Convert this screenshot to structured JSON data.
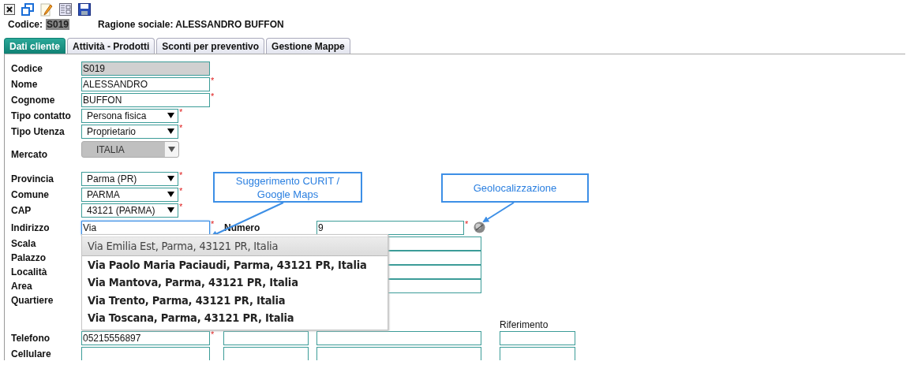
{
  "header": {
    "code_label": "Codice:",
    "code": "S019",
    "company": "Ragione sociale: ALESSANDRO BUFFON"
  },
  "tabs": [
    {
      "label": "Dati cliente",
      "selected": true
    },
    {
      "label": "Attività - Prodotti",
      "selected": false
    },
    {
      "label": "Sconti per preventivo",
      "selected": false
    },
    {
      "label": "Gestione Mappe",
      "selected": false
    }
  ],
  "rows": [
    {
      "kind": "field",
      "label": "Codice",
      "field": {
        "kind": "text",
        "value": "S019",
        "disabled": true,
        "focused": false
      }
    },
    {
      "kind": "field",
      "label": "Nome",
      "field": {
        "kind": "text",
        "value": "ALESSANDRO",
        "disabled": false,
        "focused": false,
        "required_mark": "*"
      }
    },
    {
      "kind": "field",
      "label": "Cognome",
      "field": {
        "kind": "text",
        "value": "BUFFON",
        "disabled": false,
        "focused": false,
        "required_mark": "*"
      }
    },
    {
      "kind": "field",
      "label": "Tipo contatto",
      "field": {
        "kind": "select",
        "value": "Persona fisica",
        "disabled": false,
        "required_mark": "*"
      }
    },
    {
      "kind": "field",
      "label": "Tipo Utenza",
      "field": {
        "kind": "select",
        "value": "Proprietario",
        "disabled": false,
        "required_mark": "*"
      }
    },
    {
      "kind": "field",
      "label": "Mercato",
      "field": {
        "kind": "select",
        "value": "ITALIA",
        "disabled": true
      }
    },
    {
      "kind": "field",
      "label": "Provincia",
      "field": {
        "kind": "select",
        "value": "Parma (PR)",
        "disabled": false,
        "required_mark": "*"
      }
    },
    {
      "kind": "field",
      "label": "Comune",
      "field": {
        "kind": "select",
        "value": "PARMA",
        "disabled": false,
        "required_mark": "*"
      }
    },
    {
      "kind": "field",
      "label": "CAP",
      "field": {
        "kind": "select",
        "value": "43121 (PARMA)",
        "disabled": false,
        "required_mark": "*"
      }
    },
    {
      "kind": "field",
      "label": "Indirizzo",
      "field": {
        "kind": "text",
        "value": "Via",
        "disabled": false,
        "focused": true,
        "required_mark": "*"
      },
      "number_label": "Numero",
      "number_field": {
        "kind": "text",
        "value": "9",
        "disabled": false,
        "focused": false,
        "required_mark": "*"
      }
    },
    {
      "kind": "field",
      "label": "Scala",
      "extra_field": {
        "kind": "text",
        "disabled": false,
        "focused": false
      }
    },
    {
      "kind": "field",
      "label": "Palazzo",
      "extra_field": {
        "kind": "text",
        "disabled": false,
        "focused": false
      }
    },
    {
      "kind": "field",
      "label": "Località",
      "extra_field": {
        "kind": "text",
        "disabled": false,
        "focused": false
      }
    },
    {
      "kind": "field",
      "label": "Area",
      "extra_field": {
        "kind": "text",
        "disabled": false,
        "focused": false
      }
    },
    {
      "kind": "field",
      "label": "Quartiere"
    },
    {
      "kind": "heading",
      "text": "Riferimento"
    },
    {
      "kind": "field",
      "label": "Telefono",
      "field": {
        "kind": "text",
        "value": "05215556897",
        "disabled": false,
        "focused": false,
        "required_mark": "*"
      },
      "field_2": {
        "kind": "text",
        "disabled": false,
        "focused": false
      },
      "field_3": {
        "kind": "text",
        "disabled": false,
        "focused": false
      },
      "field_4": {
        "kind": "text",
        "disabled": false,
        "focused": false
      }
    },
    {
      "kind": "field",
      "label": "Cellulare",
      "field": {
        "kind": "text",
        "disabled": false,
        "focused": false
      },
      "field_2": {
        "kind": "text",
        "disabled": false,
        "focused": false
      },
      "field_3": {
        "kind": "text",
        "disabled": false,
        "focused": false
      },
      "field_4": {
        "kind": "text",
        "disabled": false,
        "focused": false
      }
    }
  ],
  "suggestions": [
    {
      "text": "Via Emilia Est, Parma, 43121 PR, Italia",
      "selected": true
    },
    {
      "text": "Via Paolo Maria Paciaudi, Parma, 43121 PR, Italia",
      "selected": false
    },
    {
      "text": "Via Mantova, Parma, 43121 PR, Italia",
      "selected": false
    },
    {
      "text": "Via Trento, Parma, 43121 PR, Italia",
      "selected": false
    },
    {
      "text": "Via Toscana, Parma, 43121 PR, Italia",
      "selected": false
    }
  ],
  "callouts": [
    {
      "text": "Suggerimento CURIT / Google Maps"
    },
    {
      "text": "Geolocalizzazione"
    }
  ]
}
